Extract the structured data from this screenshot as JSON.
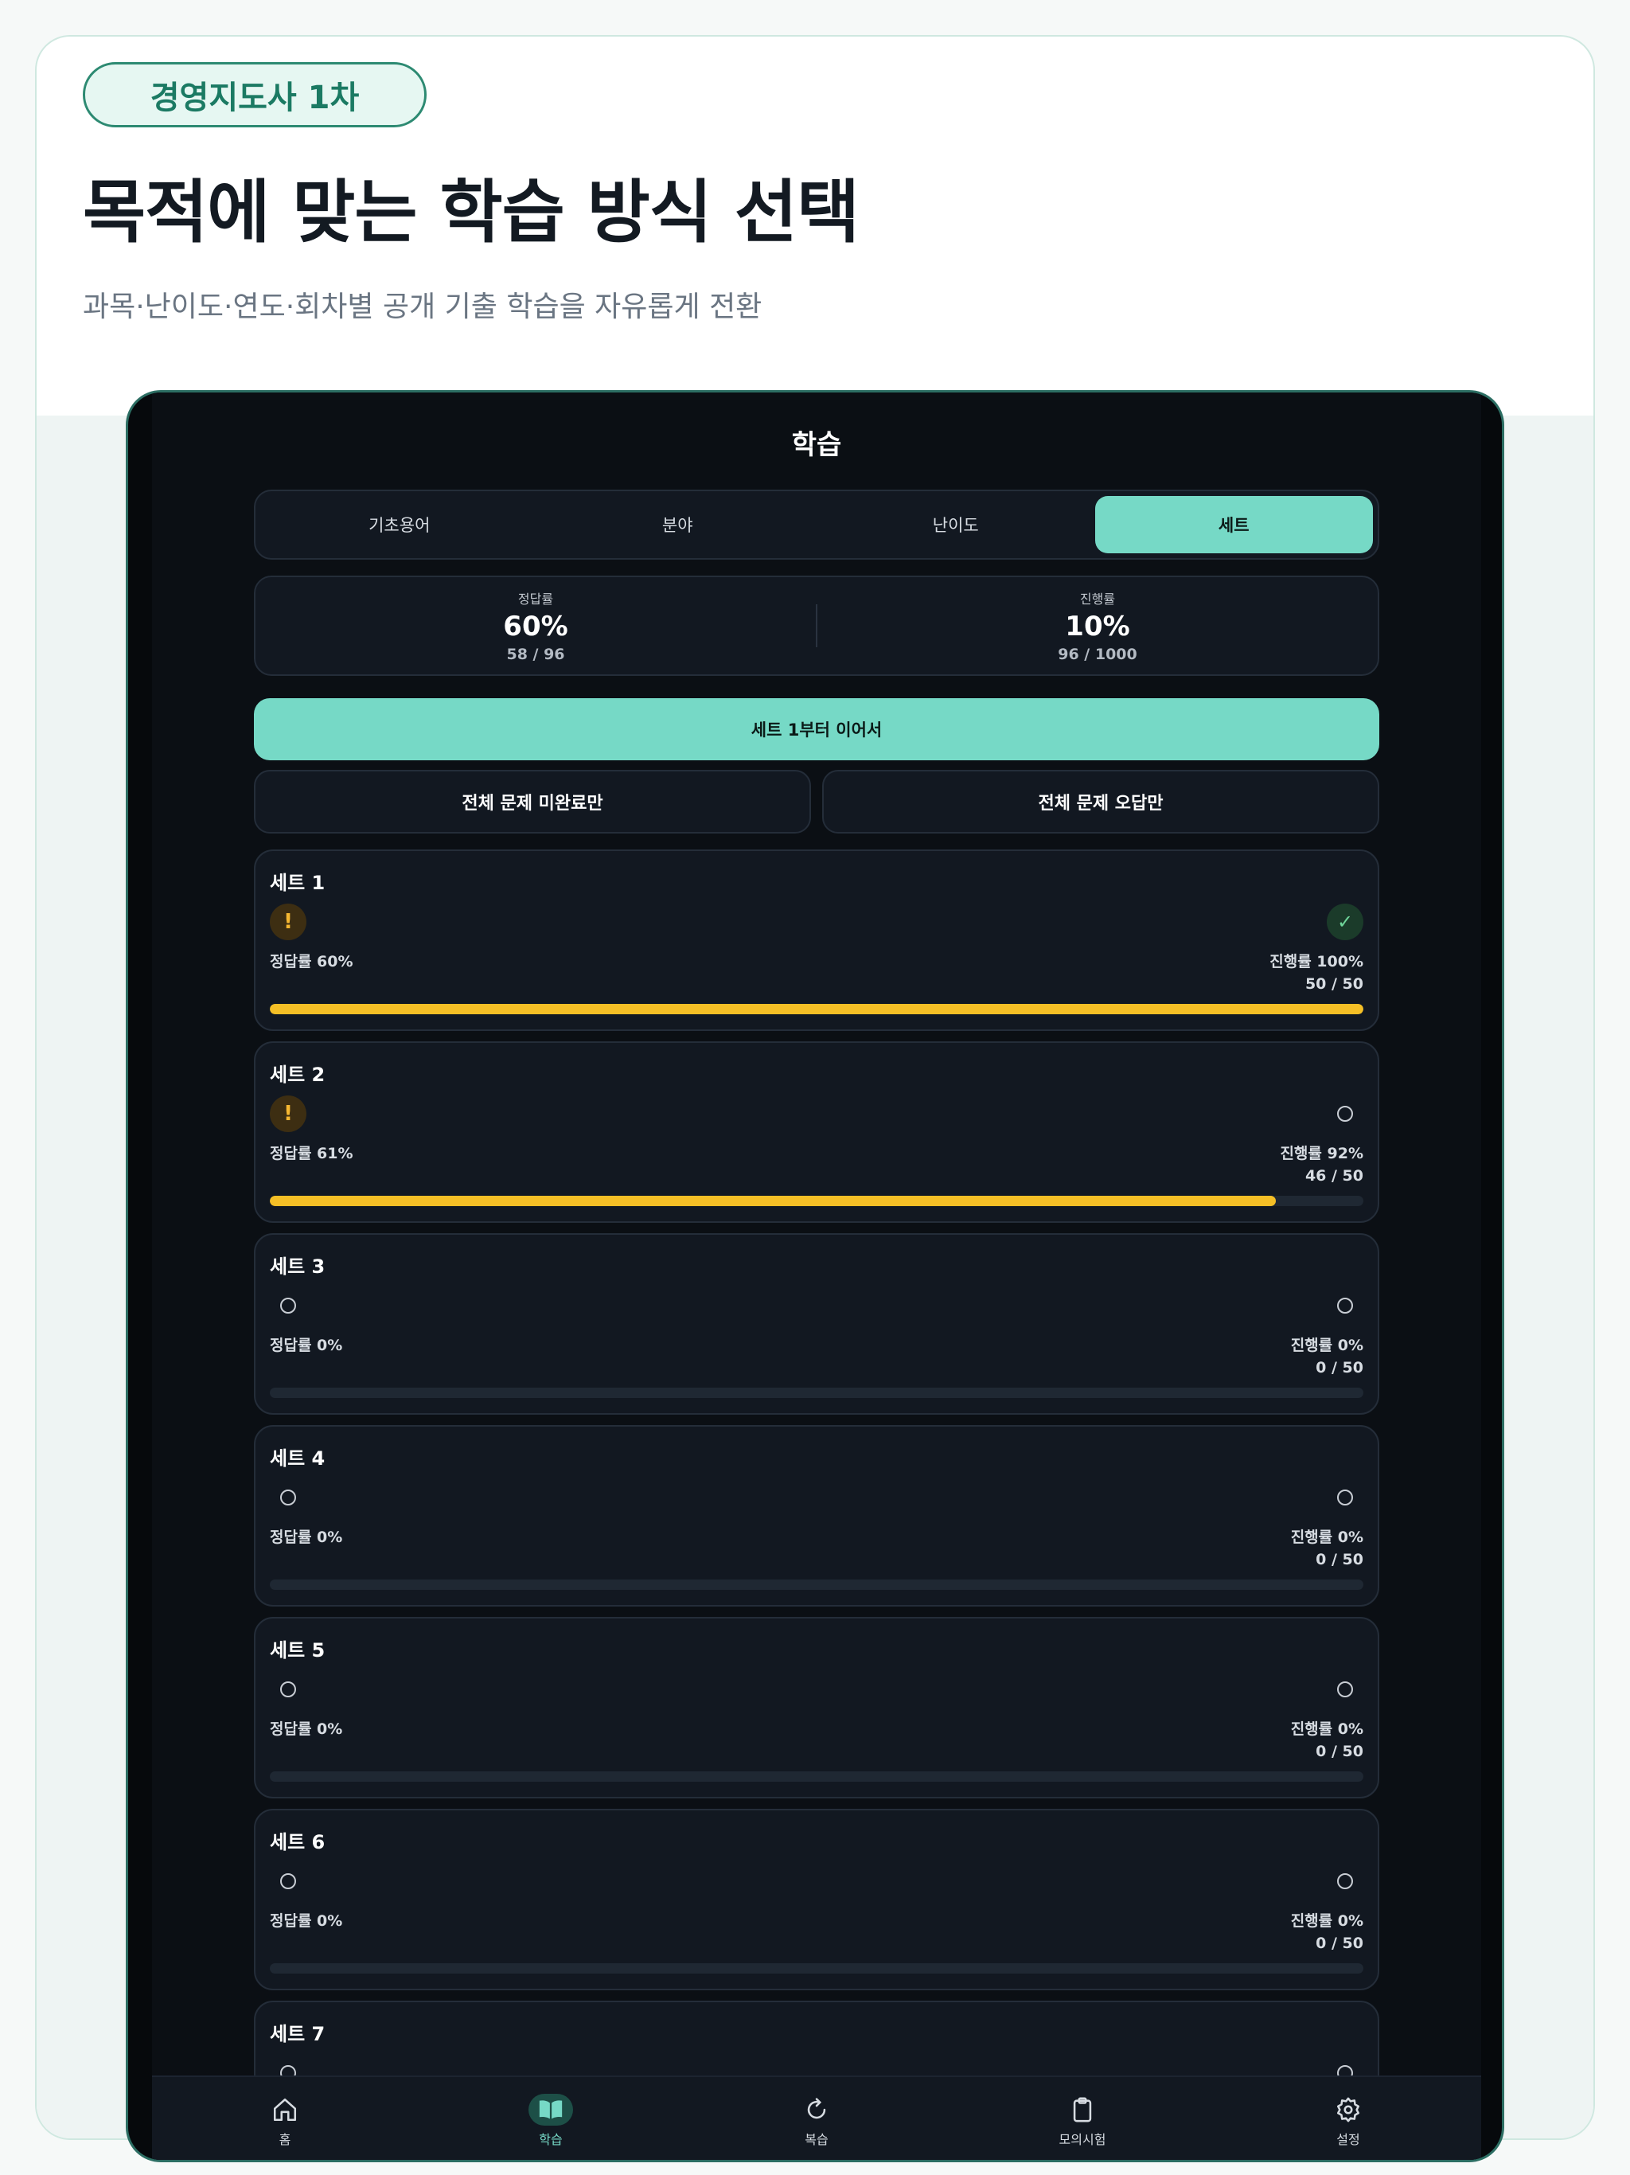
{
  "header": {
    "badge": "경영지도사 1차",
    "headline": "목적에 맞는 학습 방식 선택",
    "subline": "과목·난이도·연도·회차별 공개 기출 학습을 자유롭게 전환"
  },
  "screen": {
    "title": "학습",
    "segments": [
      "기초용어",
      "분야",
      "난이도",
      "세트"
    ],
    "active_segment": "세트",
    "stats": {
      "accuracy_label": "정답률",
      "accuracy_value": "60%",
      "accuracy_sub": "58 / 96",
      "progress_label": "진행률",
      "progress_value": "10%",
      "progress_sub": "96 / 1000"
    },
    "continue_button": "세트 1부터 이어서",
    "incomplete_button": "전체 문제 미완료만",
    "wrong_button": "전체 문제 오답만",
    "sets": [
      {
        "name": "세트 1",
        "accuracy": "정답률 60%",
        "progress": "진행률 100%",
        "count": "50 / 50",
        "fill": 1.0,
        "left_icon": "warning",
        "right_icon": "check"
      },
      {
        "name": "세트 2",
        "accuracy": "정답률 61%",
        "progress": "진행률 92%",
        "count": "46 / 50",
        "fill": 0.92,
        "left_icon": "warning",
        "right_icon": "empty"
      },
      {
        "name": "세트 3",
        "accuracy": "정답률 0%",
        "progress": "진행률 0%",
        "count": "0 / 50",
        "fill": 0,
        "left_icon": "empty",
        "right_icon": "empty"
      },
      {
        "name": "세트 4",
        "accuracy": "정답률 0%",
        "progress": "진행률 0%",
        "count": "0 / 50",
        "fill": 0,
        "left_icon": "empty",
        "right_icon": "empty"
      },
      {
        "name": "세트 5",
        "accuracy": "정답률 0%",
        "progress": "진행률 0%",
        "count": "0 / 50",
        "fill": 0,
        "left_icon": "empty",
        "right_icon": "empty"
      },
      {
        "name": "세트 6",
        "accuracy": "정답률 0%",
        "progress": "진행률 0%",
        "count": "0 / 50",
        "fill": 0,
        "left_icon": "empty",
        "right_icon": "empty"
      },
      {
        "name": "세트 7",
        "accuracy": "",
        "progress": "",
        "count": "",
        "fill": 0,
        "left_icon": "empty",
        "right_icon": "empty"
      }
    ],
    "tabbar": [
      {
        "label": "홈",
        "icon": "home-icon"
      },
      {
        "label": "학습",
        "icon": "book-icon"
      },
      {
        "label": "복습",
        "icon": "refresh-icon"
      },
      {
        "label": "모의시험",
        "icon": "clipboard-icon"
      },
      {
        "label": "설정",
        "icon": "gear-icon"
      }
    ],
    "active_tab": "학습"
  },
  "colors": {
    "accent": "#76d9c6",
    "progress_bar": "#f5bf26",
    "warning": "#f5b731",
    "success": "#6fd59a",
    "background": "#0b0f14"
  }
}
